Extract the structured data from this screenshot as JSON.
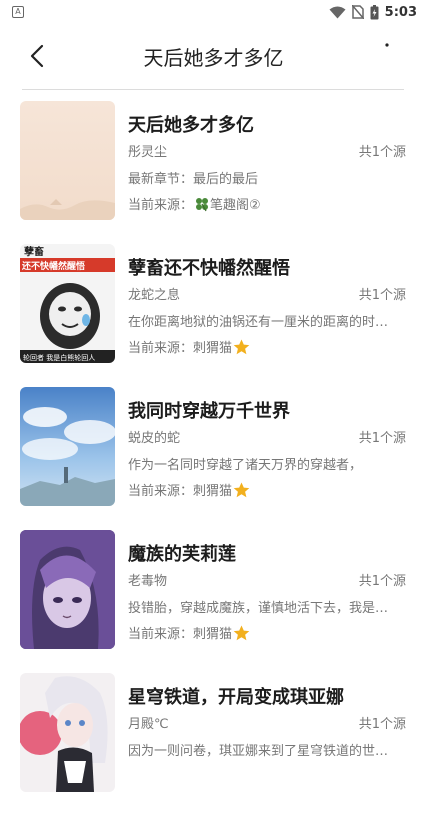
{
  "status_bar": {
    "time": "5:03",
    "icons": [
      "notification-a-icon",
      "wifi-icon",
      "no-sim-icon",
      "battery-icon"
    ]
  },
  "header": {
    "title": "天后她多才多亿",
    "back_icon": "chevron-left-icon",
    "more_icon": "more-dot-icon"
  },
  "books": [
    {
      "title": "天后她多才多亿",
      "author": "彤灵尘",
      "source_count": "共1个源",
      "latest": "最新章节：最后的最后",
      "source_prefix": "当前来源：",
      "source_name": "笔趣阁②",
      "source_icon": "clover-icon",
      "source_icon_color": "#4a8a3a"
    },
    {
      "title": "孽畜还不快幡然醒悟",
      "author": "龙蛇之息",
      "source_count": "共1个源",
      "latest": "在你距离地狱的油锅还有一厘米的距离的时候，",
      "source_prefix": "当前来源：",
      "source_name": "刺猬猫",
      "source_icon": "star-icon",
      "source_icon_color": "#f2b01e",
      "cover_text_top": "孽畜",
      "cover_text_main": "还不快幡然醒悟",
      "cover_text_bottom": "轮回者 我是白熊轮回人"
    },
    {
      "title": "我同时穿越万千世界",
      "author": "蜕皮的蛇",
      "source_count": "共1个源",
      "latest": "作为一名同时穿越了诸天万界的穿越者，",
      "source_prefix": "当前来源：",
      "source_name": "刺猬猫",
      "source_icon": "star-icon",
      "source_icon_color": "#f2b01e"
    },
    {
      "title": "魔族的芙莉莲",
      "author": "老毒物",
      "source_count": "共1个源",
      "latest": "投错胎，穿越成魔族，谨慎地活下去，我是认真的。",
      "source_prefix": "当前来源：",
      "source_name": "刺猬猫",
      "source_icon": "star-icon",
      "source_icon_color": "#f2b01e"
    },
    {
      "title": "星穹铁道，开局变成琪亚娜",
      "author": "月殿℃",
      "source_count": "共1个源",
      "latest": "因为一则问卷，琪亚娜来到了星穹铁道的世界。",
      "source_prefix": "当前来源：",
      "source_name": "刺猬猫",
      "source_icon": "star-icon",
      "source_icon_color": "#f2b01e"
    }
  ]
}
